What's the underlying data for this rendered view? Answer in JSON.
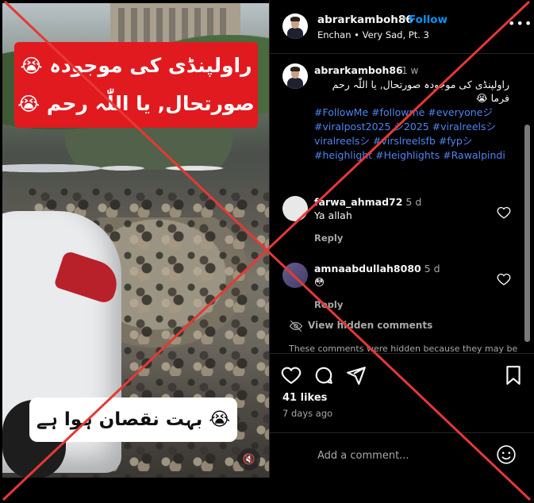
{
  "media": {
    "overlay_top_line1": "راولپنڈی کی موجودہ",
    "overlay_top_line2": "صورتحال, یا اللّٰہ رحم",
    "overlay_emoji": "😭",
    "overlay_bottom": "بہت نقصان ہوا ہے",
    "mute_icon": "🔇"
  },
  "header": {
    "username": "abrarkamboh86",
    "dot": "•",
    "follow_label": "Follow",
    "audio": "Enchan • Very Sad, Pt. 3",
    "more": "•••"
  },
  "caption": {
    "username": "abrarkamboh86",
    "time": "1 w",
    "text_line1": "راولپنڈی کی موجودہ صورتحال, یا اللّٰہ رحم",
    "text_line2": "فرما 😭",
    "hashtags": "#FollowMe #followme #everyoneジ #viralpost2025 シ2025 #viralreelsシviralreelsシ #virslreelsfb #fypシ #heighlight #Heighlights #Rawalpindi"
  },
  "comments": [
    {
      "username": "farwa_ahmad72",
      "time": "5 d",
      "text": "Ya allah",
      "reply": "Reply"
    },
    {
      "username": "amnaabdullah8080",
      "time": "5 d",
      "text": "😳",
      "reply": "Reply"
    }
  ],
  "hidden": {
    "label": "View hidden comments",
    "note": "These comments were hidden because they may be"
  },
  "actions": {
    "likes": "41 likes",
    "posted": "7 days ago"
  },
  "add_comment": {
    "placeholder": "Add a comment..."
  },
  "colors": {
    "accent": "#0095f6",
    "hashtag": "#4f84f1",
    "cross": "#e53935",
    "overlay_red": "#e11a1f"
  }
}
